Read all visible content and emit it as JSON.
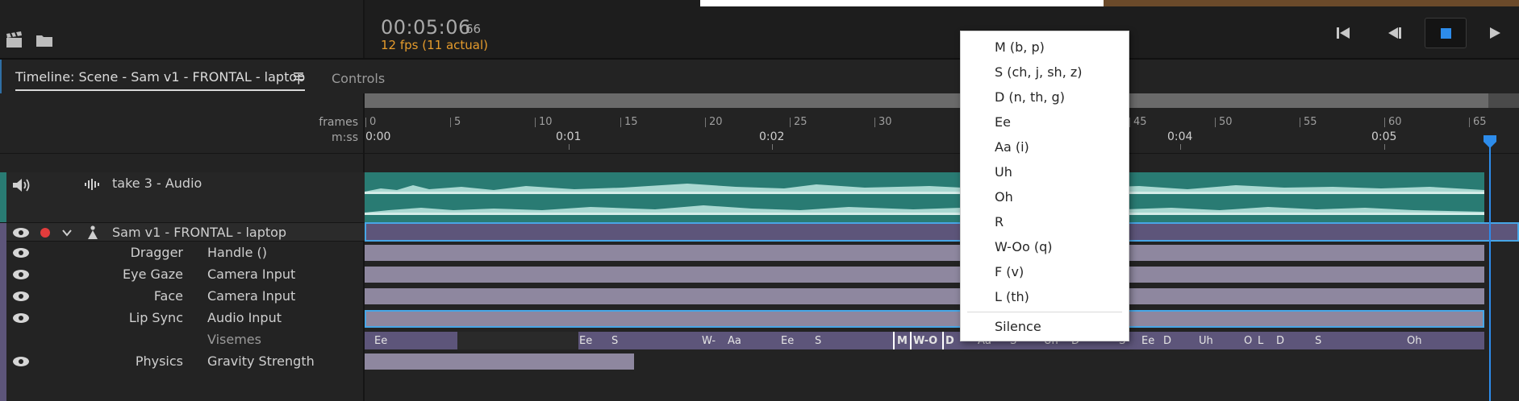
{
  "topbar": {
    "timecode": "00:05:06",
    "frame": "66",
    "fps": "12 fps (11 actual)",
    "icons": [
      "clapper-icon",
      "folder-icon",
      "skip-to-start-icon",
      "step-back-icon",
      "stop-icon",
      "play-icon"
    ],
    "accent": "#2d8ceb",
    "fps_color": "#e59b2c"
  },
  "tabs": {
    "timeline": "Timeline: Scene - Sam v1 - FRONTAL - laptop",
    "controls": "Controls"
  },
  "ruler": {
    "frames_label": "frames",
    "mss_label": "m:ss",
    "frame_ticks": [
      "0",
      "5",
      "10",
      "15",
      "20",
      "25",
      "30",
      "45",
      "50",
      "55",
      "60",
      "65"
    ],
    "second_ticks": [
      "0:00",
      "0:01",
      "0:02",
      "0:04",
      "0:05"
    ]
  },
  "tracks": {
    "audio": "take 3 - Audio",
    "puppet": "Sam v1 - FRONTAL - laptop",
    "params": [
      {
        "label": "Dragger",
        "value": "Handle ()"
      },
      {
        "label": "Eye Gaze",
        "value": "Camera Input"
      },
      {
        "label": "Face",
        "value": "Camera Input"
      },
      {
        "label": "Lip Sync",
        "value": "Audio Input"
      },
      {
        "label": "",
        "value": "Visemes"
      },
      {
        "label": "Physics",
        "value": "Gravity Strength"
      }
    ]
  },
  "visemes": [
    "Ee",
    "Ee",
    "S",
    "W-",
    "Aa",
    "Ee",
    "S",
    "M",
    "W-O",
    "D",
    "Aa",
    "S",
    "Uh",
    "D",
    "S",
    "Ee",
    "D",
    "Uh",
    "O",
    "L",
    "D",
    "S",
    "Oh"
  ],
  "menu": {
    "items": [
      "M (b, p)",
      "S (ch, j, sh, z)",
      "D (n, th, g)",
      "Ee",
      "Aa (i)",
      "Uh",
      "Oh",
      "R",
      "W-Oo (q)",
      "F (v)",
      "L (th)"
    ],
    "silence": "Silence"
  }
}
